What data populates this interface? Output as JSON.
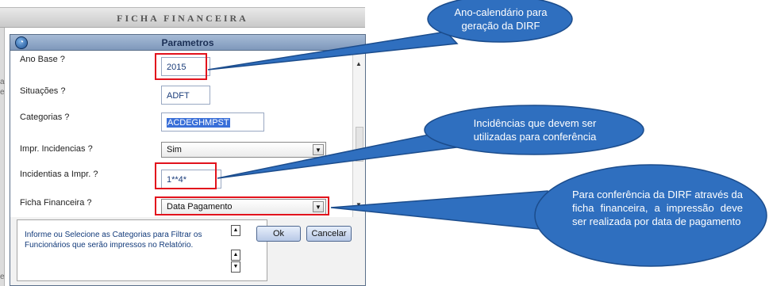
{
  "background_window": {
    "title": "FICHA FINANCEIRA",
    "edge_letters": [
      "a",
      "e",
      "e"
    ]
  },
  "dialog": {
    "title": "Parametros",
    "params": [
      {
        "label": "Ano Base ?",
        "value": "2015",
        "kind": "text"
      },
      {
        "label": "Situações ?",
        "value": "ADFT",
        "kind": "text"
      },
      {
        "label": "Categorias ?",
        "value": "ACDEGHMPST",
        "kind": "text-selected"
      },
      {
        "label": "Impr. Incidencias ?",
        "value": "Sim",
        "kind": "select"
      },
      {
        "label": "Incidentias a Impr. ?",
        "value": "1**4*",
        "kind": "text"
      },
      {
        "label": "Ficha Financeira ?",
        "value": "Data Pagamento",
        "kind": "select"
      }
    ],
    "help_text": "Informe ou Selecione as Categorias para Filtrar os Funcionários que serão impressos no Relatório.",
    "ok_label": "Ok",
    "cancel_label": "Cancelar"
  },
  "callouts": [
    {
      "text": "Ano-calendário para geração da DIRF"
    },
    {
      "text": "Incidências que devem ser utilizadas para conferência"
    },
    {
      "text": "Para conferência da DIRF através da ficha financeira, a impressão deve ser realizada por data de pagamento"
    }
  ],
  "colors": {
    "callout_fill": "#2f6fbf",
    "callout_stroke": "#1b4c8c",
    "highlight": "#e2121c"
  }
}
